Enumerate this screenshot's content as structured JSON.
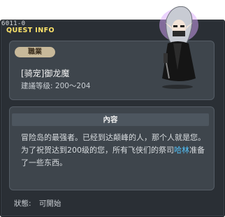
{
  "header": {
    "quest_id": "6011-0",
    "title": "QUEST INFO"
  },
  "job": {
    "badge": "職業",
    "name": "[骑宠]御龙魔",
    "level_label": "建議等级:",
    "level_range": "200～204"
  },
  "content": {
    "header": "內容",
    "text_before": "冒险岛的最强者。已经到达颠峰的人，那个人就是您。为了祝贺达到200级的您，所有飞侠们的祭司",
    "npc_name": "哈林",
    "text_after": "准备了一些东西。"
  },
  "status": {
    "label": "狀態:",
    "value": "可開始"
  },
  "colors": {
    "panel_bg": "#2a2f35",
    "title_accent": "#ffe56a",
    "npc_highlight": "#54c6ff",
    "badge_bg": "#c8b99a"
  },
  "icons": {
    "npc": "dark-knight-npc-portrait"
  }
}
